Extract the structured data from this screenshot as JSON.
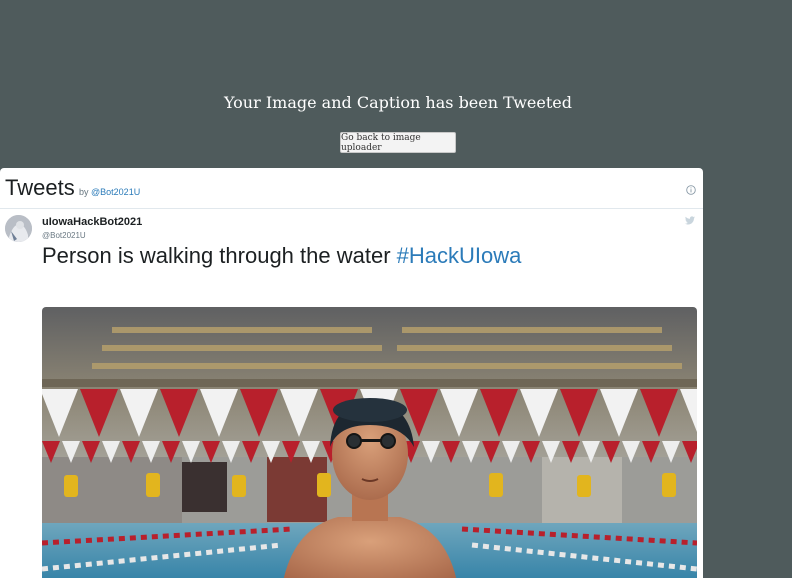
{
  "page": {
    "headline": "Your Image and Caption has been Tweeted",
    "back_button_label": "Go back to image uploader"
  },
  "widget": {
    "title": "Tweets",
    "by_prefix": "by",
    "by_handle": "@Bot2021U",
    "info_icon": "info-icon"
  },
  "tweet": {
    "user_name": "uIowaHackBot2021",
    "user_handle": "@Bot2021U",
    "text": "Person is walking through the water",
    "hashtag": "#HackUIowa",
    "bird_icon": "twitter-bird-icon",
    "photo_alt": "Swimmer in a swim cap and goggles standing at an indoor pool with red and white pennant flags"
  },
  "colors": {
    "background": "#4f5b5c",
    "link": "#2b7bb9",
    "text": "#1c2022",
    "pennant_red": "#b8202c"
  }
}
